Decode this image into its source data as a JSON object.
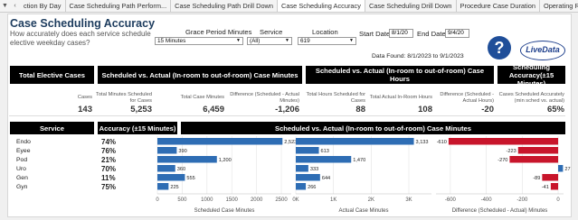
{
  "tabs": [
    {
      "label": "ction By Day"
    },
    {
      "label": "Case Scheduling Path Perform..."
    },
    {
      "label": "Case Scheduling Path Drill Down"
    },
    {
      "label": "Case Scheduling Accuracy",
      "active": true
    },
    {
      "label": "Case Scheduling Drill Down"
    },
    {
      "label": "Procedure Case Duration"
    },
    {
      "label": "Operating Room Utilizat"
    }
  ],
  "header": {
    "title": "Case Scheduling Accuracy",
    "subtitle": "How accurately does each service schedule elective weekday cases?"
  },
  "filters": {
    "grace_label": "Grace Period Minutes",
    "grace_value": "15 Minutes",
    "service_label": "Service",
    "service_value": "(All)",
    "location_label": "Location",
    "location_value": "619",
    "start_label": "Start Date",
    "start_value": "8/1/20",
    "end_label": "End Date",
    "end_value": "9/4/20"
  },
  "data_found": "Data Found: 8/1/2023 to 9/1/2023",
  "help_label": "?",
  "logo_text": "LiveData",
  "summary": {
    "h_total": "Total Elective Cases",
    "h_sched_min": "Scheduled vs. Actual (In-room to out-of-room) Case Minutes",
    "h_sched_hr": "Scheduled vs. Actual (In-room to out-of-room) Case Hours",
    "h_acc": "Scheduling Accuracy(±15 Minutes)",
    "cases_label": "Cases",
    "cases_value": "143",
    "tms_label": "Total Minutes Scheduled for Cases",
    "tms_value": "5,253",
    "tcm_label": "Total Case Minutes",
    "tcm_value": "6,459",
    "dm_label": "Difference (Scheduled - Actual Minutes)",
    "dm_value": "-1,206",
    "ths_label": "Total Hours Scheduled for Cases",
    "ths_value": "88",
    "tah_label": "Total Actual In-Room Hours",
    "tah_value": "108",
    "dh_label": "Difference (Scheduled - Actual Hours)",
    "dh_value": "-20",
    "csa_label": "Cases Scheduled Accurately (min sched vs. actual)",
    "csa_value": "65%"
  },
  "table": {
    "h_service": "Service",
    "h_accuracy": "Accuracy (±15 Minutes)",
    "h_minutes": "Scheduled vs. Actual (In-room to out-of-room) Case Minutes",
    "rows": [
      {
        "service": "Endo",
        "accuracy": "74%"
      },
      {
        "service": "Eyee",
        "accuracy": "76%"
      },
      {
        "service": "Pod",
        "accuracy": "21%"
      },
      {
        "service": "Uro",
        "accuracy": "70%"
      },
      {
        "service": "Gen",
        "accuracy": "11%"
      },
      {
        "service": "Gyn",
        "accuracy": "75%"
      }
    ]
  },
  "colors": {
    "bar_blue": "#2e6db4",
    "bar_red": "#c8152b",
    "header_bg": "#000000",
    "title": "#1d3c5e"
  },
  "chart_data": [
    {
      "type": "bar",
      "orientation": "horizontal",
      "categories": [
        "Endo",
        "Eyee",
        "Pod",
        "Uro",
        "Gen",
        "Gyn"
      ],
      "values": [
        2523,
        390,
        1200,
        360,
        555,
        225
      ],
      "value_labels": [
        "2,523",
        "390",
        "1,200",
        "360",
        "555",
        "225"
      ],
      "xlim": [
        0,
        2700
      ],
      "ticks": [
        0,
        500,
        1000,
        1500,
        2000,
        2500
      ],
      "tick_labels": [
        "0",
        "500",
        "1000",
        "1500",
        "2000",
        "2500"
      ],
      "xlabel": "Scheduled Case Minutes"
    },
    {
      "type": "bar",
      "orientation": "horizontal",
      "categories": [
        "Endo",
        "Eyee",
        "Pod",
        "Uro",
        "Gen",
        "Gyn"
      ],
      "values": [
        3133,
        613,
        1470,
        333,
        644,
        266
      ],
      "value_labels": [
        "3,133",
        "613",
        "1,470",
        "333",
        "644",
        "266"
      ],
      "xlim": [
        0,
        3600
      ],
      "ticks": [
        0,
        1000,
        2000,
        3000
      ],
      "tick_labels": [
        "0K",
        "1K",
        "2K",
        "3K"
      ],
      "xlabel": "Actual Case Minutes"
    },
    {
      "type": "bar",
      "orientation": "horizontal",
      "categories": [
        "Endo",
        "Eyee",
        "Pod",
        "Uro",
        "Gen",
        "Gyn"
      ],
      "values": [
        -610,
        -223,
        -270,
        27,
        -89,
        -41
      ],
      "value_labels": [
        "-610",
        "-223",
        "-270",
        "27",
        "-89",
        "-41"
      ],
      "xlim": [
        -680,
        30
      ],
      "ticks": [
        -600,
        -400,
        -200,
        0
      ],
      "tick_labels": [
        "-600",
        "-400",
        "-200",
        "0"
      ],
      "xlabel": "Difference (Scheduled - Actual) Minutes"
    }
  ]
}
